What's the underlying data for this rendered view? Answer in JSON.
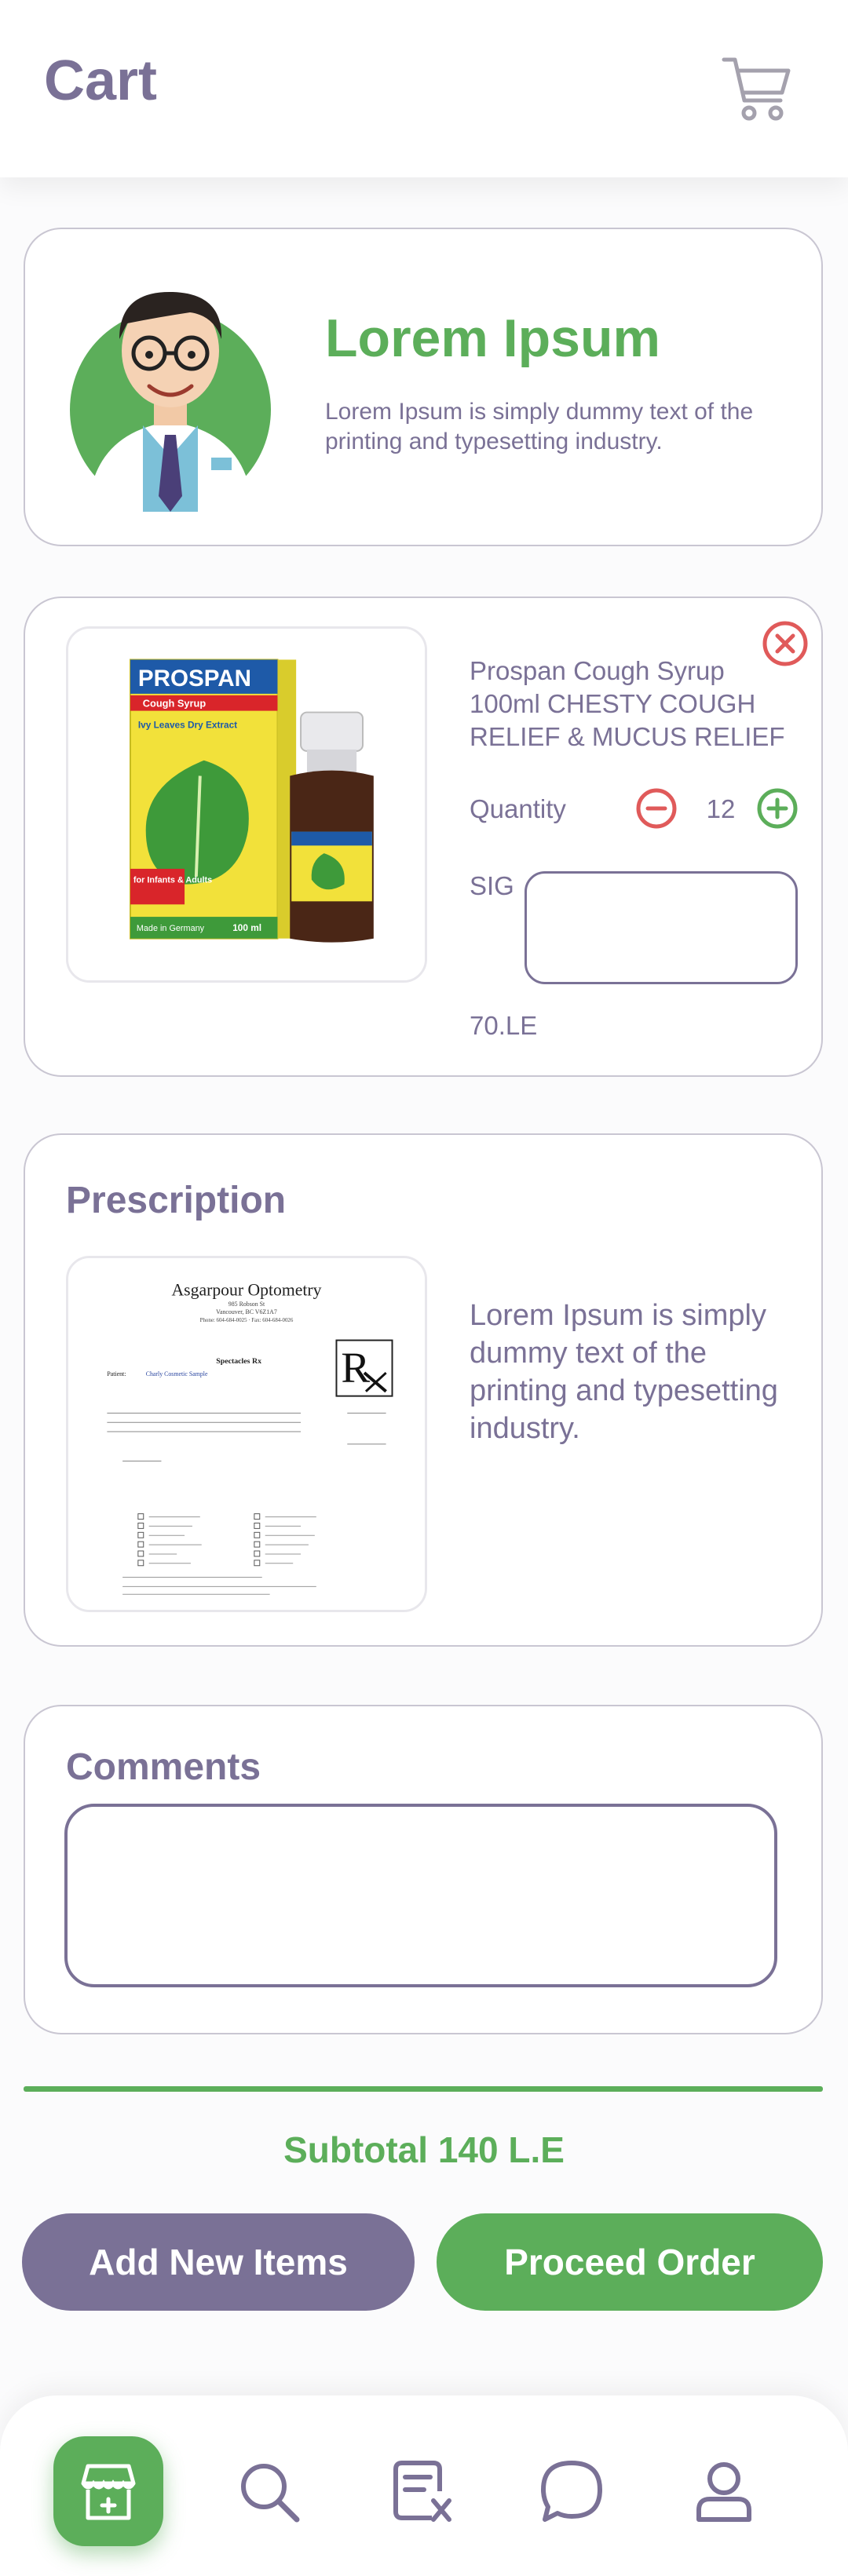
{
  "header": {
    "title": "Cart",
    "cart_icon": "cart-icon"
  },
  "promo": {
    "title": "Lorem Ipsum",
    "text": "Lorem Ipsum is simply dummy text of the printing and typesetting industry."
  },
  "item": {
    "image_text": {
      "brand": "PROSPAN",
      "product": "Cough Syrup",
      "subtitle": "Ivy Leaves Dry Extract",
      "badge": "for Infants & Adults",
      "made_in": "Made in Germany",
      "volume": "100 ml"
    },
    "name": "Prospan Cough Syrup 100ml CHESTY COUGH RELIEF & MUCUS RELIEF",
    "quantity_label": "Quantity",
    "quantity": "12",
    "sig_label": "SIG",
    "sig_value": "",
    "price": "70.LE"
  },
  "prescription": {
    "title": "Prescription",
    "image_text": {
      "clinic": "Asgarpour Optometry",
      "address": "985 Robson St",
      "city": "Vancouver, BC V6Z1A7",
      "phone": "Phone: 604-684-0025 · Fax: 604-684-0026",
      "doc_title": "Spectacles Rx",
      "patient": "Patient:",
      "patient_name": "Charly Cosmetic Sample"
    },
    "text": "Lorem Ipsum is simply dummy text of the printing and typesetting industry."
  },
  "comments": {
    "title": "Comments",
    "placeholder": ""
  },
  "summary": {
    "subtotal": "Subtotal 140 L.E"
  },
  "actions": {
    "add_label": "Add New Items",
    "proceed_label": "Proceed Order"
  },
  "bottom_nav": {
    "items": [
      "store-icon",
      "search-icon",
      "prescription-icon",
      "chat-icon",
      "profile-icon"
    ],
    "active": "store-icon"
  },
  "colors": {
    "primary": "#7a7196",
    "accent": "#5cae5a",
    "danger": "#e05a5a",
    "card_border": "#c9c6d2"
  }
}
